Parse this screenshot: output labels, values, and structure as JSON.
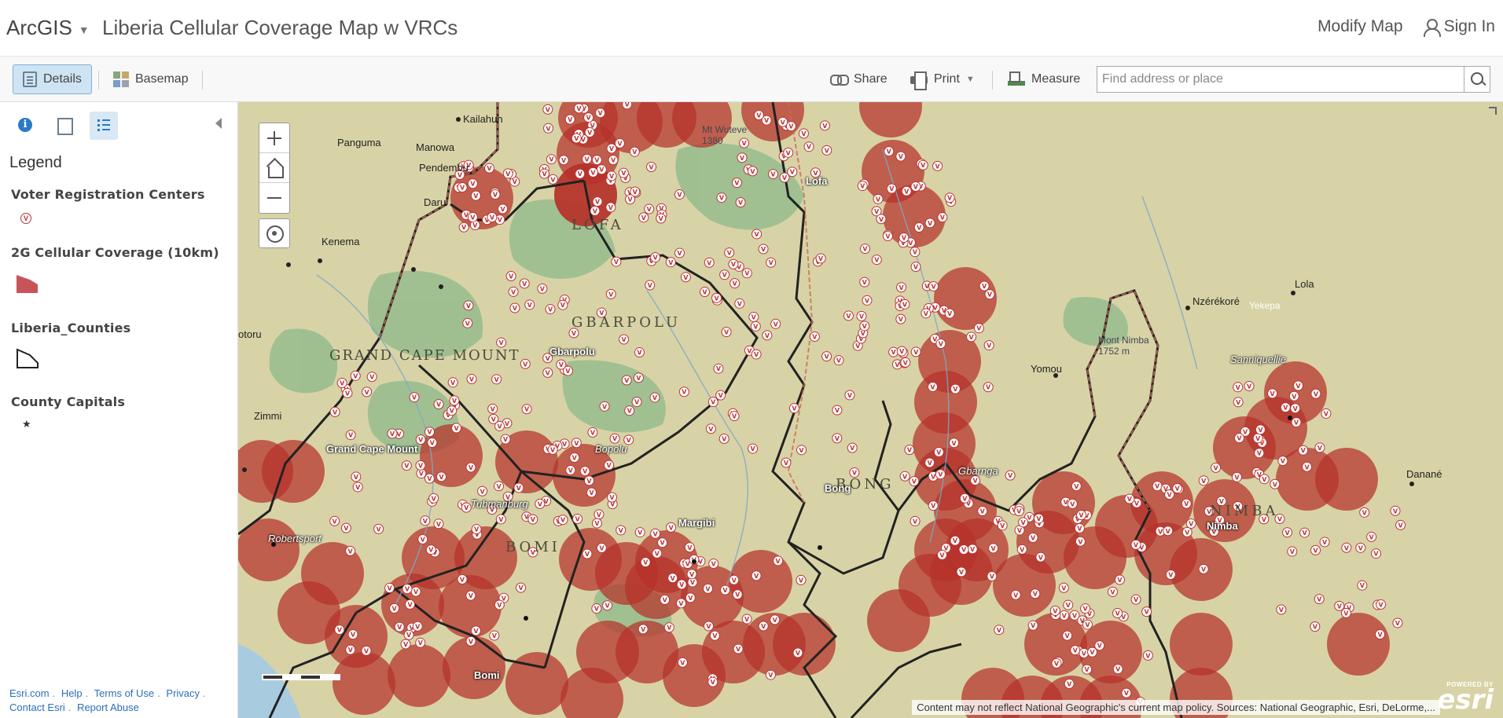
{
  "header": {
    "brand": "ArcGIS",
    "title": "Liberia Cellular Coverage Map w VRCs",
    "modify_map": "Modify Map",
    "sign_in": "Sign In"
  },
  "toolbar": {
    "details": "Details",
    "basemap": "Basemap",
    "share": "Share",
    "print": "Print",
    "measure": "Measure",
    "search_placeholder": "Find address or place"
  },
  "sidebar": {
    "legend_title": "Legend",
    "layers": [
      {
        "name": "Voter Registration Centers",
        "symbol": "V"
      },
      {
        "name": "2G Cellular Coverage (10km)",
        "symbol": "polygon-fill"
      },
      {
        "name": "Liberia_Counties",
        "symbol": "polygon-outline"
      },
      {
        "name": "County Capitals",
        "symbol": "★"
      }
    ],
    "footer": {
      "esri": "Esri.com",
      "help": "Help",
      "terms": "Terms of Use",
      "privacy": "Privacy",
      "contact": "Contact Esri",
      "abuse": "Report Abuse"
    }
  },
  "map": {
    "attribution": "Content may not reflect National Geographic's current map policy. Sources: National Geographic, Esri, DeLorme,...",
    "logo_powered": "POWERED BY",
    "logo_name": "esri",
    "labels": {
      "lofa_county": "LOFA",
      "gbarpolu_county": "GBARPOLU",
      "gcm_county": "GRAND CAPE MOUNT",
      "bong_county": "BONG",
      "nimba_county": "NIMBA",
      "bomi_county": "BOMI",
      "lofa": "Lofa",
      "gbarpolu": "Gbarpolu",
      "grand_cape_mount": "Grand Cape Mount",
      "bopolu": "Bopolu",
      "tubmanburg": "Tubmanburg",
      "bomi": "Bomi",
      "margibi": "Margibi",
      "bong": "Bong",
      "gbarnga": "Gbarnga",
      "nimba": "Nimba",
      "sanniquellie": "Sanniquellie",
      "robertsport": "Robertsport",
      "kailahun": "Kailahun",
      "panguma": "Panguma",
      "manowa": "Manowa",
      "pendembu": "Pendembu",
      "daru": "Daru",
      "kenema": "Kenema",
      "zimmi": "Zimmi",
      "fotoru": "otoru",
      "nzerekore": "Nzérékoré",
      "lola": "Lola",
      "yomou": "Yomou",
      "danane": "Danané",
      "mont_nimba": "Mont Nimba",
      "mont_nimba_elev": "1752 m",
      "yekepa": "Yekepa",
      "wuteve": "Mt Wuteve",
      "wuteve_elev": "1380"
    }
  },
  "colors": {
    "coverage": "#b5302a",
    "land": "#d8d3a6",
    "forest": "#7fae83",
    "border": "#222222",
    "accent": "#2a7ac6"
  }
}
